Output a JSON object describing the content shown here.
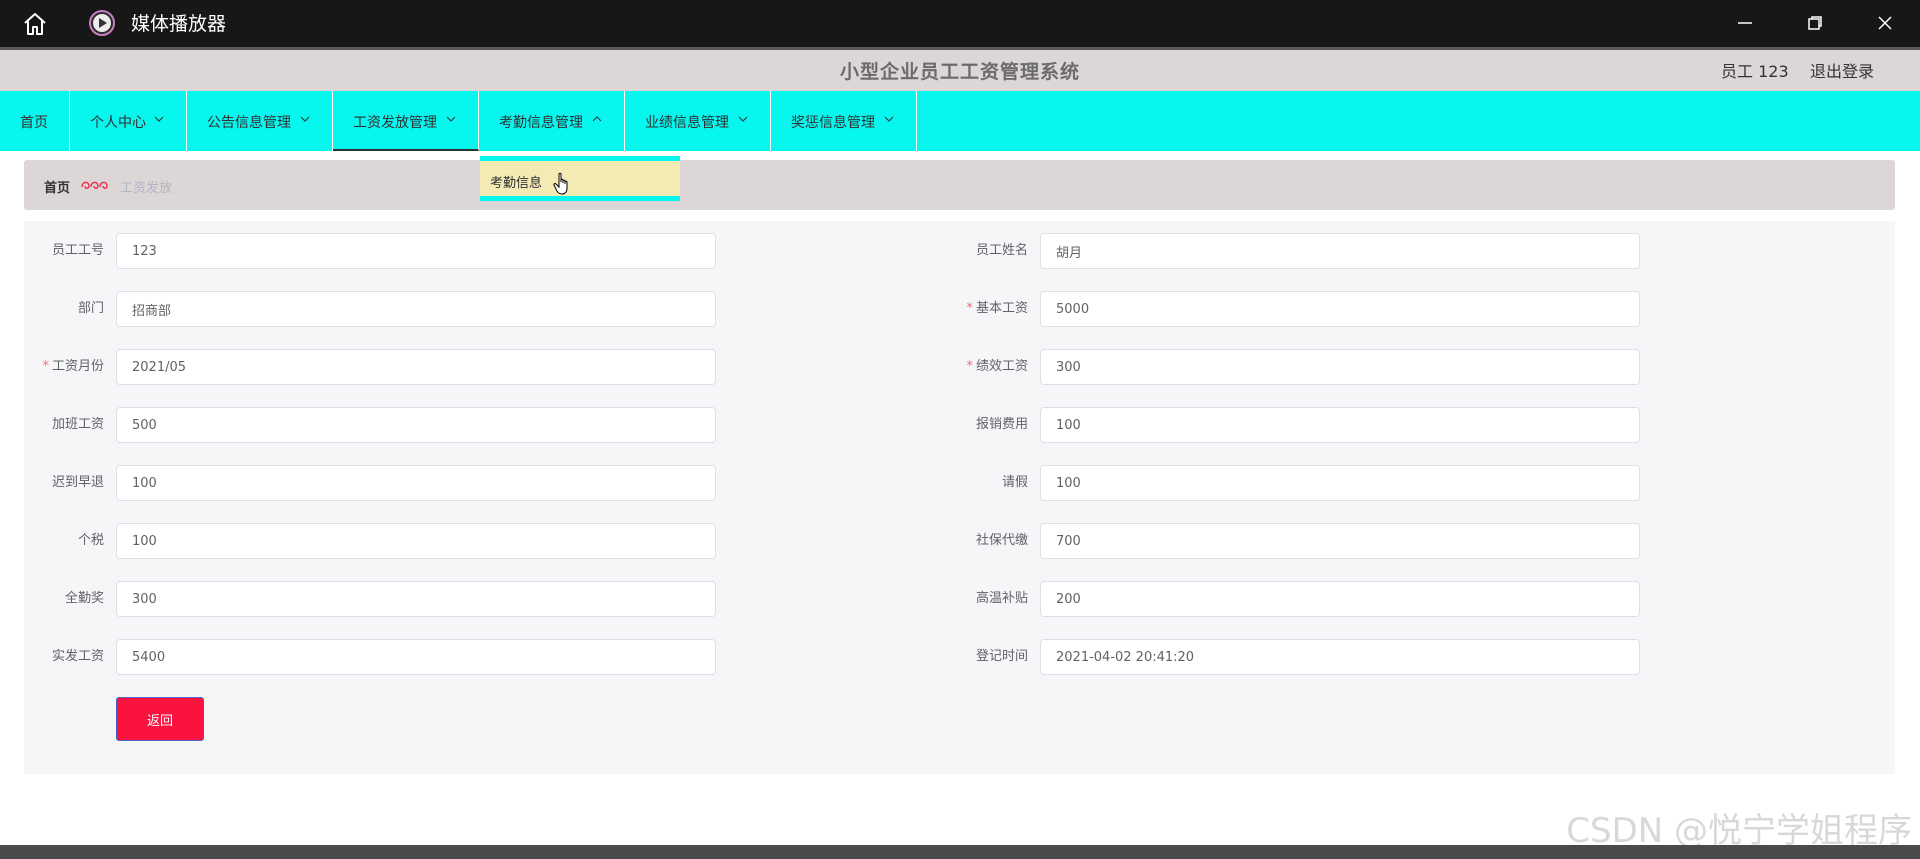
{
  "window": {
    "title": "媒体播放器",
    "home_icon": "home-icon",
    "app_icon": "play-circle-icon"
  },
  "header": {
    "title": "小型企业员工工资管理系统",
    "user": "员工 123",
    "logout": "退出登录"
  },
  "nav": {
    "items": [
      {
        "label": "首页",
        "dropdown": false
      },
      {
        "label": "个人中心",
        "dropdown": true
      },
      {
        "label": "公告信息管理",
        "dropdown": true
      },
      {
        "label": "工资发放管理",
        "dropdown": true,
        "active": true
      },
      {
        "label": "考勤信息管理",
        "dropdown": true,
        "open": true
      },
      {
        "label": "业绩信息管理",
        "dropdown": true
      },
      {
        "label": "奖惩信息管理",
        "dropdown": true
      }
    ],
    "dropdown_items": [
      "考勤信息"
    ]
  },
  "breadcrumb": {
    "home": "首页",
    "current": "工资发放"
  },
  "form": {
    "left": [
      {
        "label": "员工工号",
        "value": "123",
        "required": false
      },
      {
        "label": "部门",
        "value": "招商部",
        "required": false
      },
      {
        "label": "工资月份",
        "value": "2021/05",
        "required": true
      },
      {
        "label": "加班工资",
        "value": "500",
        "required": false
      },
      {
        "label": "迟到早退",
        "value": "100",
        "required": false
      },
      {
        "label": "个税",
        "value": "100",
        "required": false
      },
      {
        "label": "全勤奖",
        "value": "300",
        "required": false
      },
      {
        "label": "实发工资",
        "value": "5400",
        "required": false
      }
    ],
    "right": [
      {
        "label": "员工姓名",
        "value": "胡月",
        "required": false
      },
      {
        "label": "基本工资",
        "value": "5000",
        "required": true
      },
      {
        "label": "绩效工资",
        "value": "300",
        "required": true
      },
      {
        "label": "报销费用",
        "value": "100",
        "required": false
      },
      {
        "label": "请假",
        "value": "100",
        "required": false
      },
      {
        "label": "社保代缴",
        "value": "700",
        "required": false
      },
      {
        "label": "高温补贴",
        "value": "200",
        "required": false
      },
      {
        "label": "登记时间",
        "value": "2021-04-02 20:41:20",
        "required": false
      }
    ],
    "back_label": "返回"
  },
  "watermark": "CSDN @悦宁学姐程序",
  "colors": {
    "nav_bg": "#07f6ed",
    "header_bg": "#ddd6d6",
    "button_bg": "#fb1340",
    "dropdown_bg": "#f4eab3"
  }
}
